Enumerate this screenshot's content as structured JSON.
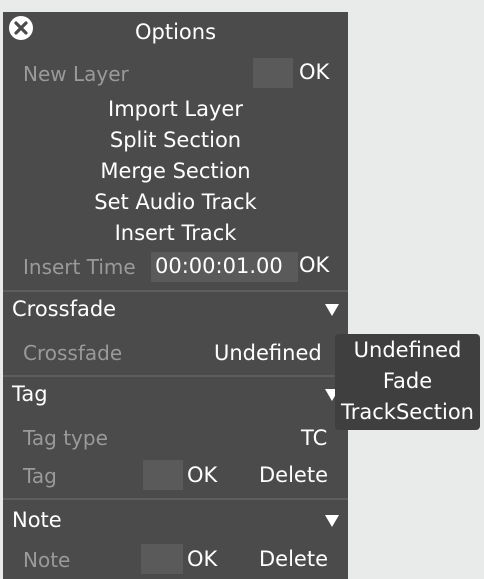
{
  "title": "Options",
  "new_layer": {
    "label": "New Layer",
    "ok": "OK"
  },
  "actions": [
    "Import Layer",
    "Split Section",
    "Merge Section",
    "Set Audio Track",
    "Insert Track"
  ],
  "insert_time": {
    "label": "Insert Time",
    "value": "00:00:01.00",
    "ok": "OK"
  },
  "crossfade": {
    "header": "Crossfade",
    "label": "Crossfade",
    "value": "Undefined",
    "options": [
      "Undefined",
      "Fade",
      "TrackSection"
    ]
  },
  "tag": {
    "header": "Tag",
    "type_label": "Tag type",
    "type_value": "TC",
    "tag_label": "Tag",
    "ok": "OK",
    "delete": "Delete"
  },
  "note": {
    "header": "Note",
    "label": "Note",
    "ok": "OK",
    "delete": "Delete"
  }
}
